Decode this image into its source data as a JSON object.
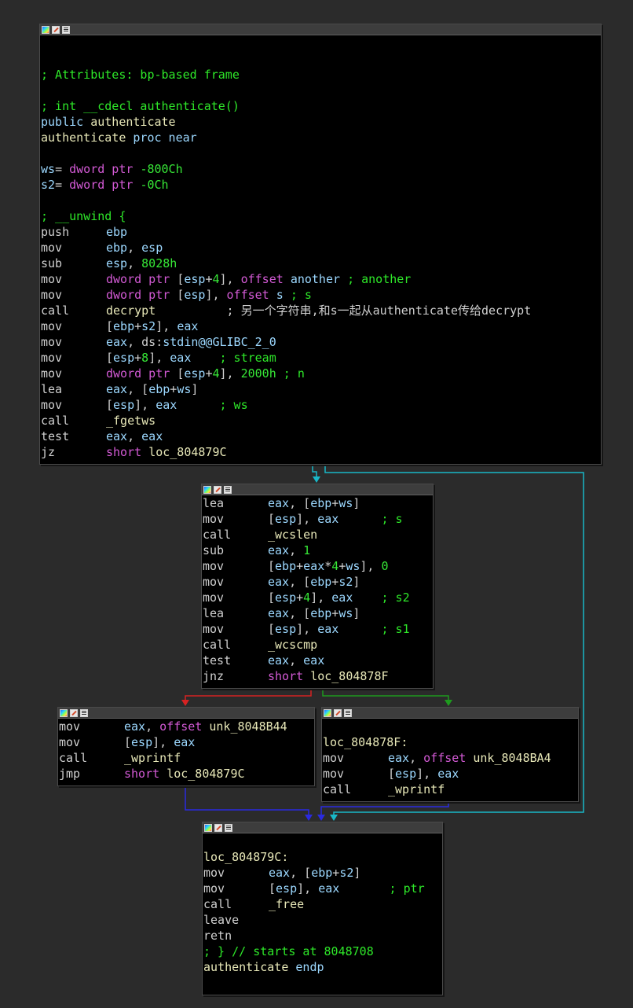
{
  "blocks": {
    "entry": {
      "lines": [
        [],
        [],
        [
          {
            "c": "c",
            "t": "; Attributes: bp-based frame"
          }
        ],
        [],
        [
          {
            "c": "c",
            "t": "; int __cdecl authenticate()"
          }
        ],
        [
          {
            "c": "k",
            "t": "public "
          },
          {
            "c": "o",
            "t": "authenticate"
          }
        ],
        [
          {
            "c": "o",
            "t": "authenticate "
          },
          {
            "c": "k",
            "t": "proc near"
          }
        ],
        [],
        [
          {
            "c": "k",
            "t": "ws"
          },
          {
            "c": "t",
            "t": "= "
          },
          {
            "c": "p",
            "t": "dword ptr "
          },
          {
            "c": "n",
            "t": "-800Ch"
          }
        ],
        [
          {
            "c": "k",
            "t": "s2"
          },
          {
            "c": "t",
            "t": "= "
          },
          {
            "c": "p",
            "t": "dword ptr "
          },
          {
            "c": "n",
            "t": "-0Ch"
          }
        ],
        [],
        [
          {
            "c": "c",
            "t": "; __unwind {"
          }
        ],
        [
          {
            "c": "m",
            "t": "push"
          },
          {
            "c": "k",
            "t": "ebp"
          }
        ],
        [
          {
            "c": "m",
            "t": "mov"
          },
          {
            "c": "k",
            "t": "ebp"
          },
          {
            "c": "t",
            "t": ", "
          },
          {
            "c": "k",
            "t": "esp"
          }
        ],
        [
          {
            "c": "m",
            "t": "sub"
          },
          {
            "c": "k",
            "t": "esp"
          },
          {
            "c": "t",
            "t": ", "
          },
          {
            "c": "n",
            "t": "8028h"
          }
        ],
        [
          {
            "c": "m",
            "t": "mov"
          },
          {
            "c": "p",
            "t": "dword ptr "
          },
          {
            "c": "t",
            "t": "["
          },
          {
            "c": "k",
            "t": "esp"
          },
          {
            "c": "t",
            "t": "+"
          },
          {
            "c": "n",
            "t": "4"
          },
          {
            "c": "t",
            "t": "], "
          },
          {
            "c": "p",
            "t": "offset "
          },
          {
            "c": "k",
            "t": "another "
          },
          {
            "c": "c",
            "t": "; another"
          }
        ],
        [
          {
            "c": "m",
            "t": "mov"
          },
          {
            "c": "p",
            "t": "dword ptr "
          },
          {
            "c": "t",
            "t": "["
          },
          {
            "c": "k",
            "t": "esp"
          },
          {
            "c": "t",
            "t": "], "
          },
          {
            "c": "p",
            "t": "offset "
          },
          {
            "c": "k",
            "t": "s "
          },
          {
            "c": "c",
            "t": "; s"
          }
        ],
        [
          {
            "c": "m",
            "t": "call"
          },
          {
            "c": "o",
            "t": "decrypt          "
          },
          {
            "c": "t",
            "t": "; 另一个字符串,和s一起从authenticate传给decrypt"
          }
        ],
        [
          {
            "c": "m",
            "t": "mov"
          },
          {
            "c": "t",
            "t": "["
          },
          {
            "c": "k",
            "t": "ebp"
          },
          {
            "c": "t",
            "t": "+"
          },
          {
            "c": "k",
            "t": "s2"
          },
          {
            "c": "t",
            "t": "], "
          },
          {
            "c": "k",
            "t": "eax"
          }
        ],
        [
          {
            "c": "m",
            "t": "mov"
          },
          {
            "c": "k",
            "t": "eax"
          },
          {
            "c": "t",
            "t": ", ds:"
          },
          {
            "c": "k",
            "t": "stdin@@GLIBC_2_0"
          }
        ],
        [
          {
            "c": "m",
            "t": "mov"
          },
          {
            "c": "t",
            "t": "["
          },
          {
            "c": "k",
            "t": "esp"
          },
          {
            "c": "t",
            "t": "+"
          },
          {
            "c": "n",
            "t": "8"
          },
          {
            "c": "t",
            "t": "], "
          },
          {
            "c": "k",
            "t": "eax"
          },
          {
            "c": "t",
            "t": "    "
          },
          {
            "c": "c",
            "t": "; stream"
          }
        ],
        [
          {
            "c": "m",
            "t": "mov"
          },
          {
            "c": "p",
            "t": "dword ptr "
          },
          {
            "c": "t",
            "t": "["
          },
          {
            "c": "k",
            "t": "esp"
          },
          {
            "c": "t",
            "t": "+"
          },
          {
            "c": "n",
            "t": "4"
          },
          {
            "c": "t",
            "t": "], "
          },
          {
            "c": "n",
            "t": "2000h"
          },
          {
            "c": "c",
            "t": " ; n"
          }
        ],
        [
          {
            "c": "m",
            "t": "lea"
          },
          {
            "c": "k",
            "t": "eax"
          },
          {
            "c": "t",
            "t": ", ["
          },
          {
            "c": "k",
            "t": "ebp"
          },
          {
            "c": "t",
            "t": "+"
          },
          {
            "c": "k",
            "t": "ws"
          },
          {
            "c": "t",
            "t": "]"
          }
        ],
        [
          {
            "c": "m",
            "t": "mov"
          },
          {
            "c": "t",
            "t": "["
          },
          {
            "c": "k",
            "t": "esp"
          },
          {
            "c": "t",
            "t": "], "
          },
          {
            "c": "k",
            "t": "eax"
          },
          {
            "c": "t",
            "t": "      "
          },
          {
            "c": "c",
            "t": "; ws"
          }
        ],
        [
          {
            "c": "m",
            "t": "call"
          },
          {
            "c": "o",
            "t": "_fgetws"
          }
        ],
        [
          {
            "c": "m",
            "t": "test"
          },
          {
            "c": "k",
            "t": "eax"
          },
          {
            "c": "t",
            "t": ", "
          },
          {
            "c": "k",
            "t": "eax"
          }
        ],
        [
          {
            "c": "m",
            "t": "jz"
          },
          {
            "c": "p",
            "t": "short "
          },
          {
            "c": "o",
            "t": "loc_804879C"
          }
        ]
      ]
    },
    "compare": {
      "lines": [
        [
          {
            "c": "m",
            "t": "lea"
          },
          {
            "c": "k",
            "t": "eax"
          },
          {
            "c": "t",
            "t": ", ["
          },
          {
            "c": "k",
            "t": "ebp"
          },
          {
            "c": "t",
            "t": "+"
          },
          {
            "c": "k",
            "t": "ws"
          },
          {
            "c": "t",
            "t": "]"
          }
        ],
        [
          {
            "c": "m",
            "t": "mov"
          },
          {
            "c": "t",
            "t": "["
          },
          {
            "c": "k",
            "t": "esp"
          },
          {
            "c": "t",
            "t": "], "
          },
          {
            "c": "k",
            "t": "eax"
          },
          {
            "c": "t",
            "t": "      "
          },
          {
            "c": "c",
            "t": "; s"
          }
        ],
        [
          {
            "c": "m",
            "t": "call"
          },
          {
            "c": "o",
            "t": "_wcslen"
          }
        ],
        [
          {
            "c": "m",
            "t": "sub"
          },
          {
            "c": "k",
            "t": "eax"
          },
          {
            "c": "t",
            "t": ", "
          },
          {
            "c": "n",
            "t": "1"
          }
        ],
        [
          {
            "c": "m",
            "t": "mov"
          },
          {
            "c": "t",
            "t": "["
          },
          {
            "c": "k",
            "t": "ebp"
          },
          {
            "c": "t",
            "t": "+"
          },
          {
            "c": "k",
            "t": "eax"
          },
          {
            "c": "t",
            "t": "*"
          },
          {
            "c": "n",
            "t": "4"
          },
          {
            "c": "t",
            "t": "+"
          },
          {
            "c": "k",
            "t": "ws"
          },
          {
            "c": "t",
            "t": "], "
          },
          {
            "c": "n",
            "t": "0"
          }
        ],
        [
          {
            "c": "m",
            "t": "mov"
          },
          {
            "c": "k",
            "t": "eax"
          },
          {
            "c": "t",
            "t": ", ["
          },
          {
            "c": "k",
            "t": "ebp"
          },
          {
            "c": "t",
            "t": "+"
          },
          {
            "c": "k",
            "t": "s2"
          },
          {
            "c": "t",
            "t": "]"
          }
        ],
        [
          {
            "c": "m",
            "t": "mov"
          },
          {
            "c": "t",
            "t": "["
          },
          {
            "c": "k",
            "t": "esp"
          },
          {
            "c": "t",
            "t": "+"
          },
          {
            "c": "n",
            "t": "4"
          },
          {
            "c": "t",
            "t": "], "
          },
          {
            "c": "k",
            "t": "eax"
          },
          {
            "c": "t",
            "t": "    "
          },
          {
            "c": "c",
            "t": "; s2"
          }
        ],
        [
          {
            "c": "m",
            "t": "lea"
          },
          {
            "c": "k",
            "t": "eax"
          },
          {
            "c": "t",
            "t": ", ["
          },
          {
            "c": "k",
            "t": "ebp"
          },
          {
            "c": "t",
            "t": "+"
          },
          {
            "c": "k",
            "t": "ws"
          },
          {
            "c": "t",
            "t": "]"
          }
        ],
        [
          {
            "c": "m",
            "t": "mov"
          },
          {
            "c": "t",
            "t": "["
          },
          {
            "c": "k",
            "t": "esp"
          },
          {
            "c": "t",
            "t": "], "
          },
          {
            "c": "k",
            "t": "eax"
          },
          {
            "c": "t",
            "t": "      "
          },
          {
            "c": "c",
            "t": "; s1"
          }
        ],
        [
          {
            "c": "m",
            "t": "call"
          },
          {
            "c": "o",
            "t": "_wcscmp"
          }
        ],
        [
          {
            "c": "m",
            "t": "test"
          },
          {
            "c": "k",
            "t": "eax"
          },
          {
            "c": "t",
            "t": ", "
          },
          {
            "c": "k",
            "t": "eax"
          }
        ],
        [
          {
            "c": "m",
            "t": "jnz"
          },
          {
            "c": "p",
            "t": "short "
          },
          {
            "c": "o",
            "t": "loc_804878F"
          }
        ]
      ]
    },
    "success": {
      "lines": [
        [
          {
            "c": "m",
            "t": "mov"
          },
          {
            "c": "k",
            "t": "eax"
          },
          {
            "c": "t",
            "t": ", "
          },
          {
            "c": "p",
            "t": "offset "
          },
          {
            "c": "o",
            "t": "unk_8048B44"
          }
        ],
        [
          {
            "c": "m",
            "t": "mov"
          },
          {
            "c": "t",
            "t": "["
          },
          {
            "c": "k",
            "t": "esp"
          },
          {
            "c": "t",
            "t": "], "
          },
          {
            "c": "k",
            "t": "eax"
          }
        ],
        [
          {
            "c": "m",
            "t": "call"
          },
          {
            "c": "o",
            "t": "_wprintf"
          }
        ],
        [
          {
            "c": "m",
            "t": "jmp"
          },
          {
            "c": "p",
            "t": "short "
          },
          {
            "c": "o",
            "t": "loc_804879C"
          }
        ]
      ]
    },
    "failure": {
      "lines": [
        [],
        [
          {
            "c": "o",
            "t": "loc_804878F:"
          }
        ],
        [
          {
            "c": "m",
            "t": "mov"
          },
          {
            "c": "k",
            "t": "eax"
          },
          {
            "c": "t",
            "t": ", "
          },
          {
            "c": "p",
            "t": "offset "
          },
          {
            "c": "o",
            "t": "unk_8048BA4"
          }
        ],
        [
          {
            "c": "m",
            "t": "mov"
          },
          {
            "c": "t",
            "t": "["
          },
          {
            "c": "k",
            "t": "esp"
          },
          {
            "c": "t",
            "t": "], "
          },
          {
            "c": "k",
            "t": "eax"
          }
        ],
        [
          {
            "c": "m",
            "t": "call"
          },
          {
            "c": "o",
            "t": "_wprintf"
          }
        ]
      ]
    },
    "exit": {
      "lines": [
        [],
        [
          {
            "c": "o",
            "t": "loc_804879C:"
          }
        ],
        [
          {
            "c": "m",
            "t": "mov"
          },
          {
            "c": "k",
            "t": "eax"
          },
          {
            "c": "t",
            "t": ", ["
          },
          {
            "c": "k",
            "t": "ebp"
          },
          {
            "c": "t",
            "t": "+"
          },
          {
            "c": "k",
            "t": "s2"
          },
          {
            "c": "t",
            "t": "]"
          }
        ],
        [
          {
            "c": "m",
            "t": "mov"
          },
          {
            "c": "t",
            "t": "["
          },
          {
            "c": "k",
            "t": "esp"
          },
          {
            "c": "t",
            "t": "], "
          },
          {
            "c": "k",
            "t": "eax"
          },
          {
            "c": "t",
            "t": "       "
          },
          {
            "c": "c",
            "t": "; ptr"
          }
        ],
        [
          {
            "c": "m",
            "t": "call"
          },
          {
            "c": "o",
            "t": "_free"
          }
        ],
        [
          {
            "c": "m",
            "t": "leave"
          }
        ],
        [
          {
            "c": "m",
            "t": "retn"
          }
        ],
        [
          {
            "c": "c",
            "t": "; } // starts at 8048708"
          }
        ],
        [
          {
            "c": "o",
            "t": "authenticate "
          },
          {
            "c": "k",
            "t": "endp"
          }
        ]
      ]
    }
  },
  "colors": {
    "edge_false": "#d62222",
    "edge_true": "#1e9a1e",
    "edge_uncond": "#2a2ae0",
    "edge_jz": "#19b8c8"
  },
  "icons": [
    "graph-icon",
    "pencil-icon",
    "listing-icon"
  ]
}
